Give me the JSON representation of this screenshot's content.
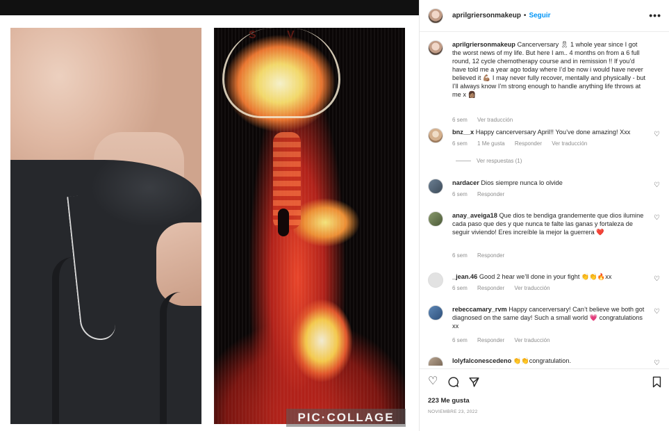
{
  "post": {
    "username": "aprilgriersonmakeup",
    "follow_label": "Seguir",
    "more_icon": "more-horizontal-icon",
    "watermark": "PIC·COLLAGE",
    "scan_text": "S V"
  },
  "caption": {
    "username": "aprilgriersonmakeup",
    "text": "Cancerversary 🎗 1 whole year since I got the worst news of my life. But here I am.. 4 months on from a 6 full round, 12 cycle chemotherapy course and in remission !! If you’d have told me a year ago today where I’d be now i would have never believed it 💪🏽 I may never fully recover, mentally and physically - but I’ll always know I’m strong enough to handle anything life throws at me x 👩🏽",
    "time": "6 sem",
    "translate": "Ver traducción"
  },
  "comments": [
    {
      "username": "bnz__x",
      "text": "Happy cancerversary April!! You’ve done amazing! Xxx",
      "time": "6 sem",
      "likes": "1 Me gusta",
      "reply": "Responder",
      "translate": "Ver traducción",
      "replies": "Ver respuestas (1)"
    },
    {
      "username": "nardacer",
      "text": "Dios siempre nunca lo olvide",
      "time": "6 sem",
      "reply": "Responder"
    },
    {
      "username": "anay_aveiga18",
      "text": "Que dios te bendiga grandemente que dios ilumine cada paso que des y que nunca te falte las ganas y fortaleza de seguir viviendo! Eres increíble la mejor la guerrera ❤️",
      "time": "6 sem",
      "reply": "Responder"
    },
    {
      "username": "_jean.46",
      "text": "Good 2 hear we’ll done in your fight 👏👏🔥xx",
      "time": "6 sem",
      "reply": "Responder",
      "translate": "Ver traducción"
    },
    {
      "username": "rebeccamary_rvm",
      "text": "Happy cancerversary! Can’t believe we both got diagnosed on the same day! Such a small world 💗 congratulations xx",
      "time": "6 sem",
      "reply": "Responder",
      "translate": "Ver traducción"
    },
    {
      "username": "lolyfalconescedeno",
      "text": "👏👏congratulation."
    }
  ],
  "actions": {
    "like_icon": "heart-icon",
    "comment_icon": "comment-icon",
    "share_icon": "share-icon",
    "save_icon": "bookmark-icon",
    "likes": "223 Me gusta",
    "date": "NOVIEMBRE 23, 2022"
  },
  "colors": {
    "link": "#0095f6",
    "meta": "#8e8e8e",
    "text": "#262626"
  }
}
